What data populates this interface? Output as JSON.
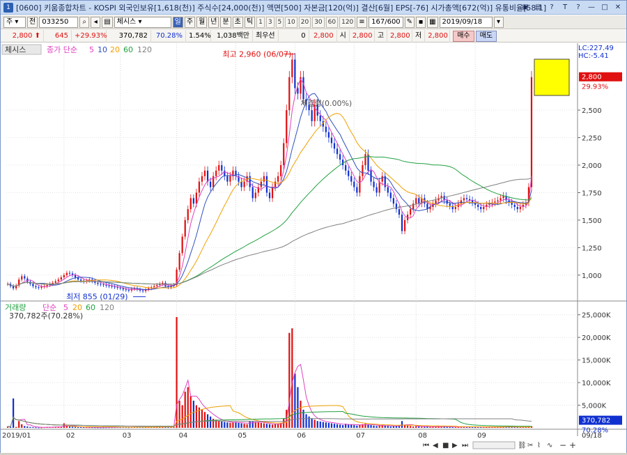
{
  "titlebar": {
    "icon": "1",
    "title": "[0600] 키움종합차트 - KOSPI 외국인보유[1,618(천)] 주식수[24,000(천)] 액면[500] 자본금[120(억)] 결산[6월] EPS[-76] 시가총액[672(억)] 유통비율[58.1]",
    "buttons": [
      "▣",
      "▤",
      "?",
      "T",
      "?",
      "—",
      "□",
      "✕"
    ]
  },
  "toolbar": {
    "market": "주",
    "market_alt": "전",
    "code": "033250",
    "name": "체시스",
    "period_buttons": [
      "일",
      "주",
      "월",
      "년",
      "분",
      "초",
      "틱"
    ],
    "minute_buttons": [
      "1",
      "3",
      "5",
      "10",
      "20",
      "30",
      "60",
      "120"
    ],
    "count": "167/600",
    "date": "2019/09/18"
  },
  "quote": {
    "price": "2,800",
    "change": "645",
    "change_pct": "+29.93%",
    "volume": "370,782",
    "vol_ratio": "70.28%",
    "turnover": "1.54%",
    "amount": "1,038백만",
    "best_sell_label": "최우선",
    "best_sell_val": "0",
    "price2": "2,800",
    "open_label": "시",
    "open": "2,800",
    "high_label": "고",
    "high": "2,800",
    "low_label": "저",
    "low": "2,800",
    "buy_label": "매수",
    "sell_label": "매도"
  },
  "chart_data": {
    "type": "line",
    "price_pane": {
      "title": "체시스",
      "legend_prefix": "종가 단순",
      "ma_periods": [
        "5",
        "10",
        "20",
        "60",
        "120"
      ],
      "ma_colors": [
        "#e040c0",
        "#3050c0",
        "#f0a000",
        "#20a040",
        "#808080"
      ],
      "ylim": [
        790,
        3020
      ],
      "yticks": [
        1000,
        1250,
        1500,
        1750,
        2000,
        2250,
        2500
      ],
      "ytick_labels": [
        "1,000",
        "1,250",
        "1,500",
        "1,750",
        "2,000",
        "2,250",
        "2,500"
      ],
      "lc_label": "LC:227.49",
      "hc_label": "HC:-5.41",
      "last_price_label": "2,800",
      "last_pct_label": "29.93%",
      "last_price": 2800,
      "high_annotation": "최고 2,960 (06/07)",
      "high_value": 2960,
      "low_annotation": "최저 855 (01/29)",
      "low_value": 855,
      "center_annotation": "체결량(0.00%)"
    },
    "volume_pane": {
      "title": "거래량",
      "legend_prefix": "단순",
      "ma_periods": [
        "5",
        "20",
        "60",
        "120"
      ],
      "ma_colors": [
        "#e040c0",
        "#f0a000",
        "#20a040",
        "#808080"
      ],
      "current_label": "370,782주(70.28%)",
      "ylim": [
        0,
        26500
      ],
      "yticks": [
        5000,
        10000,
        15000,
        20000,
        25000
      ],
      "ytick_labels": [
        "5,000K",
        "10,000K",
        "15,000K",
        "20,000K",
        "25,000K"
      ],
      "last_volume_label": "370,782",
      "last_pct_label": "70.28%"
    },
    "x_axis": {
      "labels": [
        "2019/01",
        "02",
        "03",
        "04",
        "05",
        "06",
        "07",
        "08",
        "09",
        "09/18"
      ],
      "label_idx": [
        0,
        20,
        40,
        60,
        81,
        102,
        123,
        145,
        166,
        186
      ]
    },
    "series": [
      {
        "name": "close",
        "values": [
          920,
          900,
          880,
          905,
          960,
          990,
          970,
          940,
          920,
          900,
          890,
          885,
          895,
          900,
          910,
          920,
          930,
          945,
          960,
          980,
          1000,
          1020,
          1015,
          1000,
          980,
          960,
          950,
          940,
          950,
          960,
          945,
          930,
          920,
          915,
          910,
          905,
          900,
          895,
          890,
          885,
          880,
          870,
          865,
          860,
          875,
          880,
          870,
          860,
          855,
          870,
          880,
          890,
          900,
          910,
          920,
          930,
          900,
          890,
          900,
          910,
          1050,
          1200,
          1350,
          1500,
          1600,
          1700,
          1650,
          1750,
          1850,
          1900,
          1950,
          1850,
          1800,
          1900,
          1950,
          2000,
          1950,
          1900,
          1850,
          1900,
          1950,
          1900,
          1850,
          1800,
          1850,
          1900,
          1800,
          1700,
          1750,
          1800,
          1850,
          1900,
          1750,
          1700,
          1800,
          1850,
          1900,
          2000,
          2200,
          2500,
          2800,
          2960,
          2700,
          2650,
          2800,
          2600,
          2550,
          2500,
          2400,
          2550,
          2450,
          2400,
          2350,
          2300,
          2250,
          2200,
          2150,
          2100,
          2050,
          2000,
          1950,
          1900,
          1850,
          1800,
          1750,
          1900,
          2000,
          2100,
          1950,
          1850,
          1800,
          1750,
          1850,
          1900,
          1800,
          1750,
          1700,
          1650,
          1600,
          1550,
          1400,
          1500,
          1550,
          1600,
          1650,
          1700,
          1650,
          1700,
          1650,
          1600,
          1620,
          1650,
          1680,
          1700,
          1720,
          1680,
          1650,
          1630,
          1600,
          1620,
          1650,
          1680,
          1700,
          1690,
          1680,
          1660,
          1640,
          1620,
          1600,
          1620,
          1640,
          1650,
          1660,
          1670,
          1680,
          1700,
          1720,
          1680,
          1660,
          1640,
          1620,
          1600,
          1620,
          1640,
          1660,
          1800,
          2800
        ]
      },
      {
        "name": "volume",
        "values": [
          300,
          200,
          6500,
          200,
          1500,
          800,
          400,
          300,
          200,
          150,
          120,
          100,
          100,
          150,
          200,
          180,
          160,
          200,
          250,
          300,
          1000,
          400,
          300,
          250,
          200,
          180,
          160,
          150,
          140,
          130,
          120,
          110,
          100,
          100,
          100,
          110,
          120,
          130,
          140,
          150,
          180,
          160,
          140,
          130,
          150,
          200,
          180,
          170,
          160,
          150,
          180,
          200,
          250,
          300,
          400,
          300,
          250,
          200,
          220,
          250,
          24500,
          6000,
          5000,
          8000,
          9000,
          7000,
          6000,
          5000,
          4500,
          4000,
          3500,
          3000,
          2500,
          2000,
          1800,
          1500,
          1400,
          1300,
          1200,
          1100,
          1200,
          1300,
          1100,
          1000,
          900,
          800,
          1500,
          1400,
          1300,
          1200,
          1100,
          1000,
          900,
          800,
          700,
          800,
          900,
          1000,
          2000,
          4000,
          21000,
          22000,
          12000,
          9000,
          6000,
          4000,
          3000,
          2500,
          2000,
          1800,
          1500,
          1400,
          1300,
          1200,
          1100,
          1000,
          900,
          800,
          700,
          600,
          900,
          800,
          700,
          600,
          500,
          700,
          800,
          900,
          700,
          600,
          500,
          400,
          500,
          600,
          500,
          400,
          300,
          350,
          400,
          500,
          1500,
          600,
          500,
          400,
          300,
          350,
          300,
          250,
          300,
          250,
          200,
          250,
          300,
          350,
          300,
          250,
          200,
          180,
          160,
          170,
          180,
          200,
          220,
          210,
          200,
          190,
          180,
          170,
          160,
          170,
          180,
          190,
          200,
          210,
          220,
          230,
          240,
          230,
          220,
          210,
          200,
          190,
          200,
          210,
          220,
          300,
          370
        ]
      }
    ]
  }
}
